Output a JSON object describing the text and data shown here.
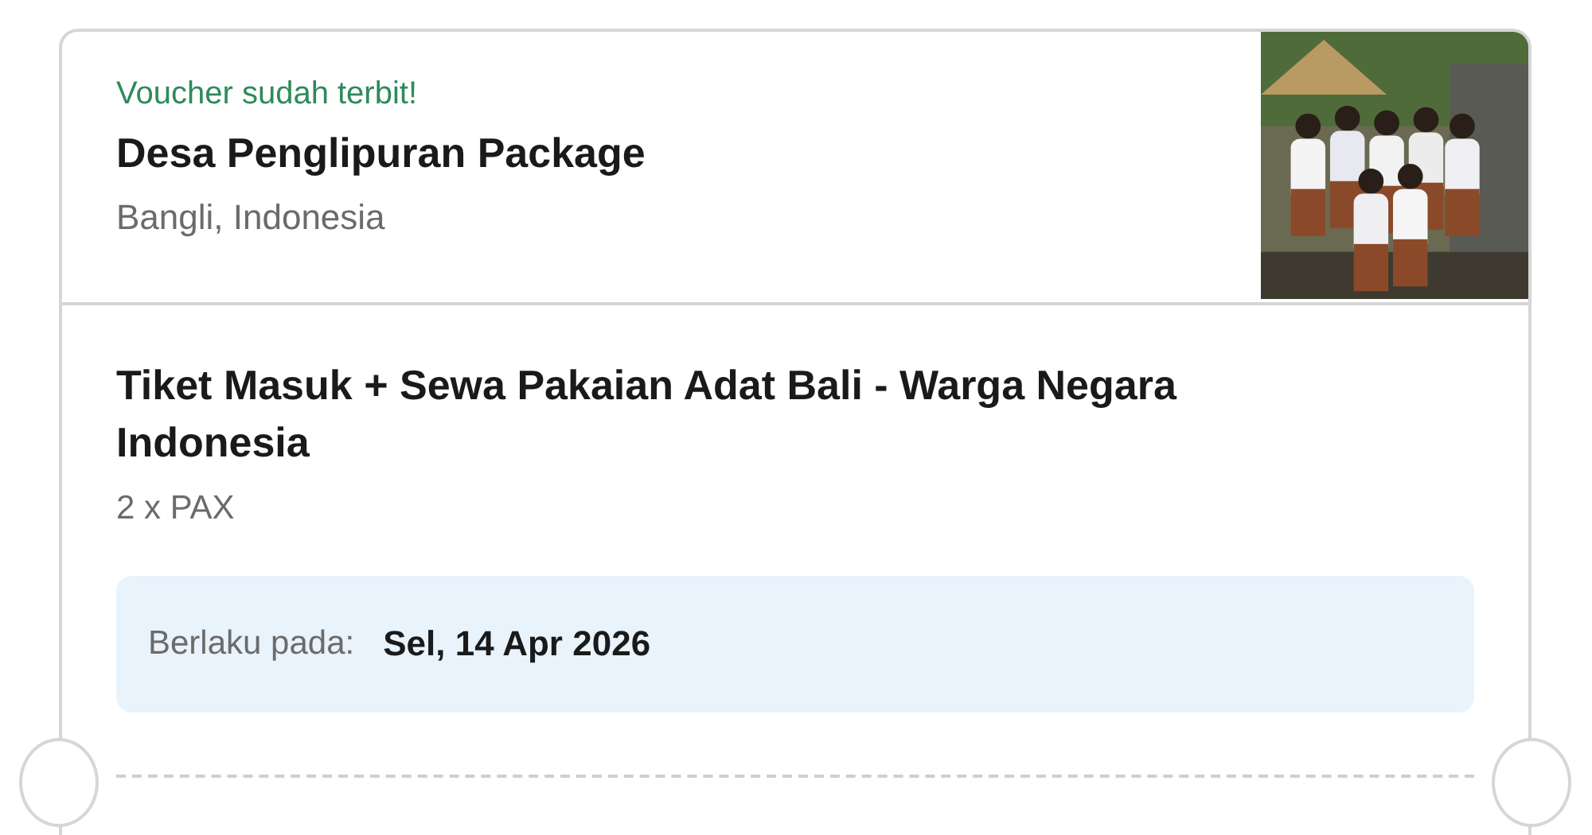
{
  "voucher": {
    "status": "Voucher sudah terbit!",
    "title": "Desa Penglipuran Package",
    "location": "Bangli, Indonesia"
  },
  "ticket": {
    "name": "Tiket Masuk + Sewa Pakaian Adat Bali - Warga Negara Indonesia",
    "quantity": "2 x PAX",
    "validity": {
      "label": "Berlaku pada:",
      "date": "Sel, 14 Apr 2026"
    }
  }
}
